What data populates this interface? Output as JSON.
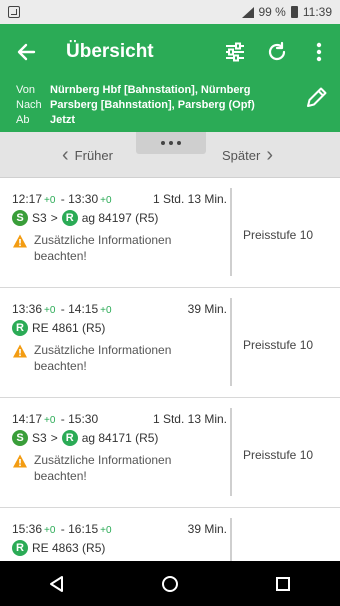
{
  "status_bar": {
    "battery": "99 %",
    "time": "11:39"
  },
  "app_bar": {
    "title": "Übersicht"
  },
  "route": {
    "from_label": "Von",
    "from_value": "Nürnberg Hbf [Bahnstation], Nürnberg",
    "to_label": "Nach",
    "to_value": "Parsberg [Bahnstation], Parsberg (Opf)",
    "dep_label": "Ab",
    "dep_value": "Jetzt"
  },
  "nav": {
    "earlier": "Früher",
    "later": "Später"
  },
  "connections": [
    {
      "dep": "12:17",
      "dep_delay": "+0",
      "arr": "13:30",
      "arr_delay": "+0",
      "duration": "1 Std. 13 Min.",
      "first_line": "S3",
      "second_line": "ag 84197 (R5)",
      "has_s": true,
      "info": "Zusätzliche Informationen beachten!",
      "price": "Preisstufe 10"
    },
    {
      "dep": "13:36",
      "dep_delay": "+0",
      "arr": "14:15",
      "arr_delay": "+0",
      "duration": "39 Min.",
      "first_line": "",
      "second_line": "RE 4861 (R5)",
      "has_s": false,
      "info": "Zusätzliche Informationen beachten!",
      "price": "Preisstufe 10"
    },
    {
      "dep": "14:17",
      "dep_delay": "+0",
      "arr": "15:30",
      "arr_delay": "",
      "duration": "1 Std. 13 Min.",
      "first_line": "S3",
      "second_line": "ag 84171 (R5)",
      "has_s": true,
      "info": "Zusätzliche Informationen beachten!",
      "price": "Preisstufe 10"
    },
    {
      "dep": "15:36",
      "dep_delay": "+0",
      "arr": "16:15",
      "arr_delay": "+0",
      "duration": "39 Min.",
      "first_line": "",
      "second_line": "RE 4863 (R5)",
      "has_s": false,
      "info": "",
      "price": ""
    }
  ],
  "icons": {
    "back": "back-arrow-icon",
    "filter": "filter-sliders-icon",
    "refresh": "refresh-icon",
    "more": "more-vertical-icon",
    "edit": "edit-pencil-icon",
    "warning": "warning-icon"
  },
  "colors": {
    "primary": "#2bab56",
    "warning": "#f39c12"
  }
}
